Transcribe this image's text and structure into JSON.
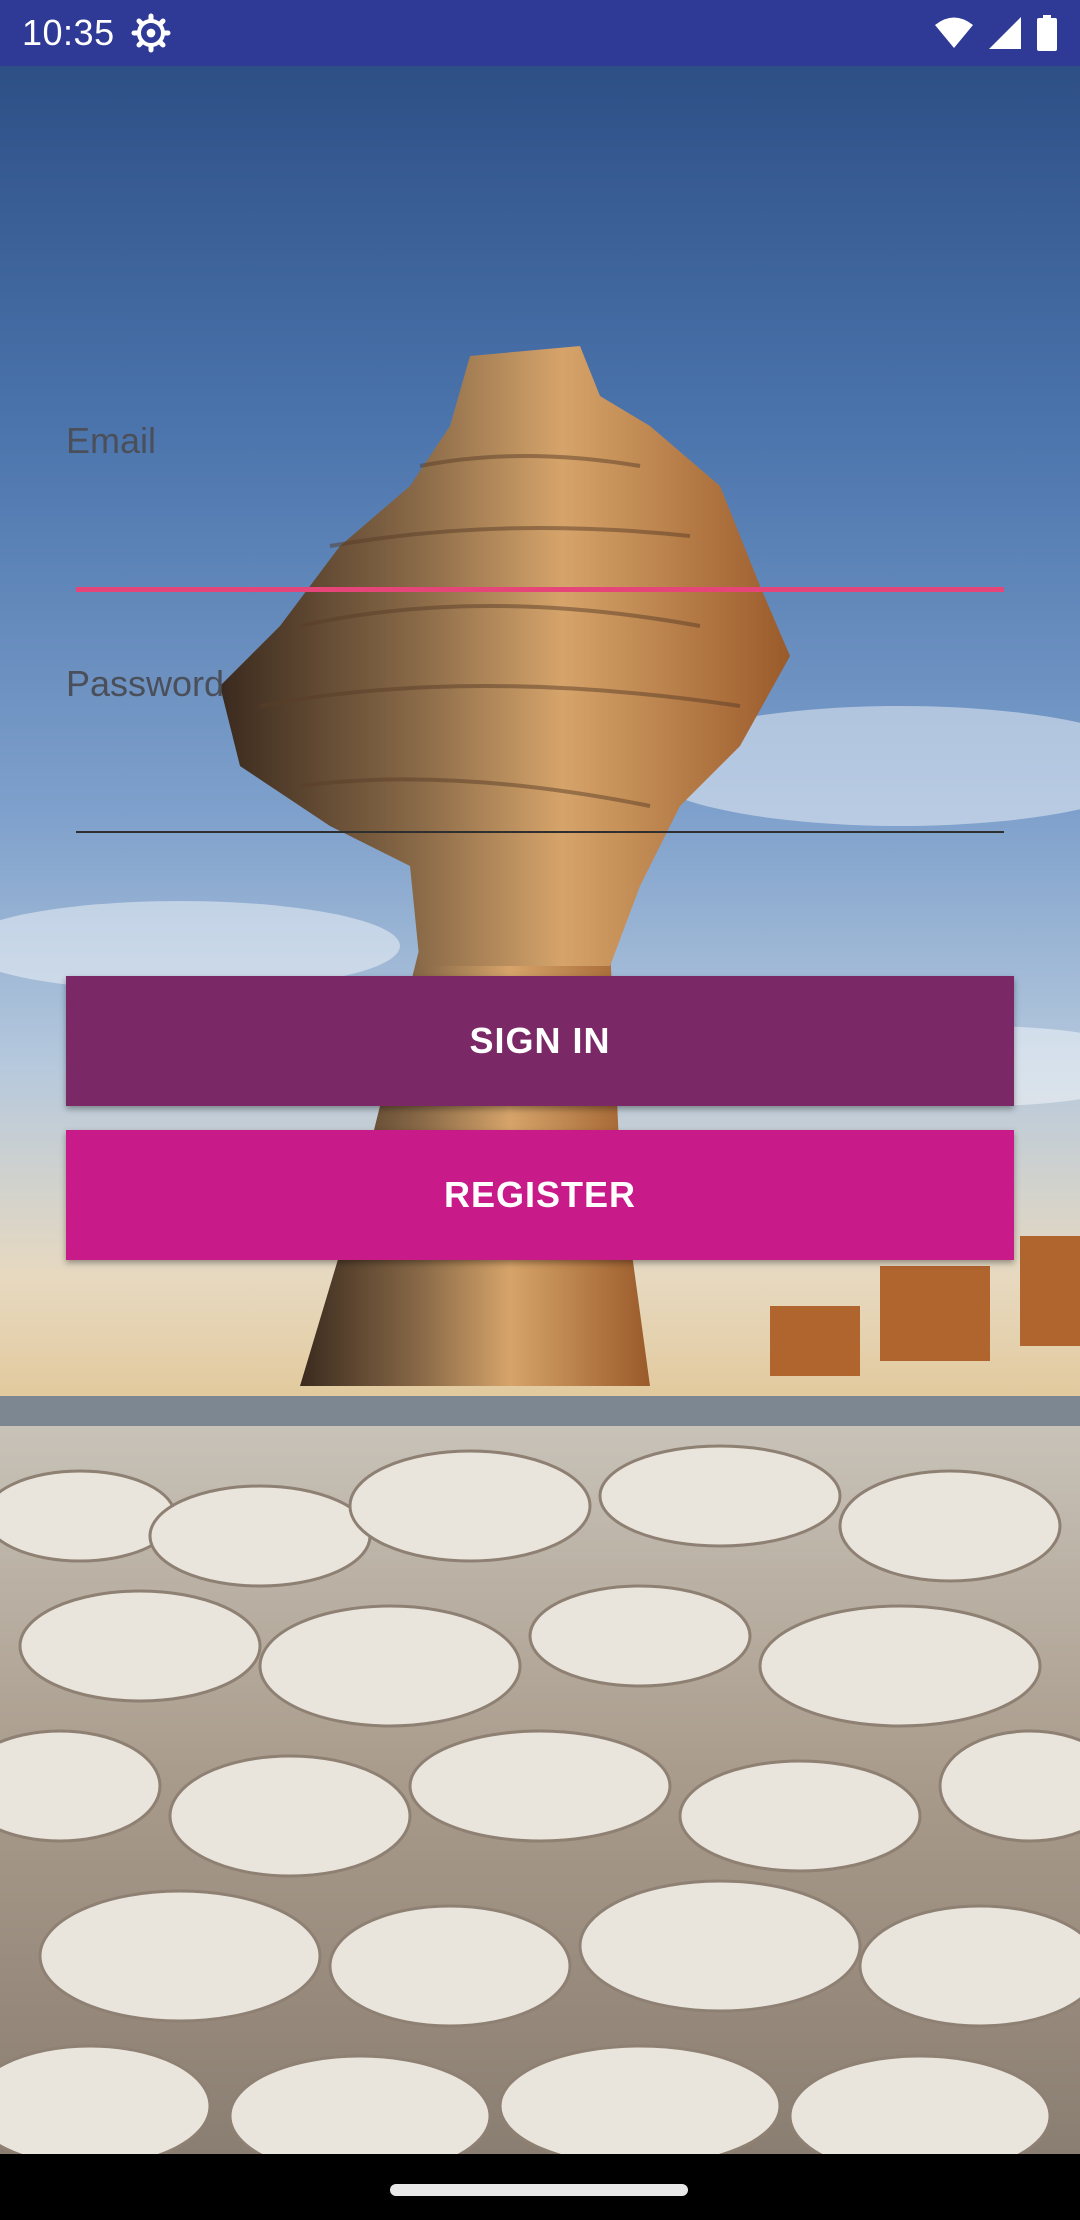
{
  "status_bar": {
    "time": "10:35",
    "icons": [
      "settings-gear-icon",
      "wifi-icon",
      "signal-icon",
      "battery-icon"
    ],
    "background_color": "#2f3a96"
  },
  "form": {
    "email_label": "Email",
    "password_label": "Password",
    "email_underline_color": "#e6457a",
    "password_underline_color": "#2f2f2f"
  },
  "buttons": {
    "sign_in_label": "SIGN IN",
    "sign_in_color": "#7b2866",
    "register_label": "REGISTER",
    "register_color": "#c91a89"
  },
  "background": {
    "image": "rock-pillar-over-salt-flats-photo"
  },
  "nav_bar": {
    "icons": [
      "home-indicator"
    ]
  }
}
